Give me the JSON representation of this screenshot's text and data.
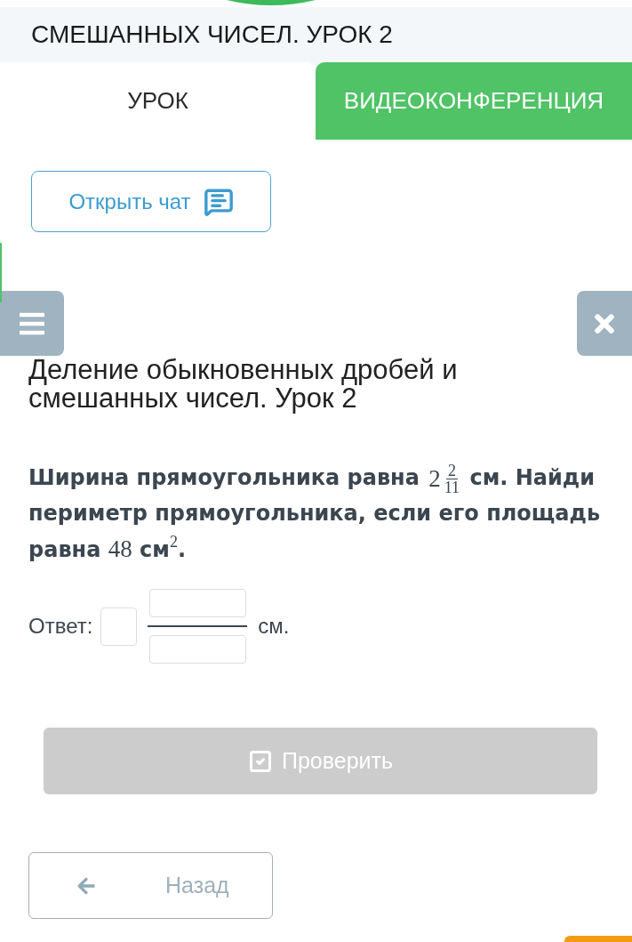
{
  "header": {
    "title": "СМЕШАННЫХ ЧИСЕЛ. УРОК 2"
  },
  "tabs": [
    {
      "label": "УРОК",
      "selected": true
    },
    {
      "label": "ВИДЕОКОНФЕРЕНЦИЯ",
      "selected": false
    }
  ],
  "chat_button": {
    "label": "Открыть чат"
  },
  "lesson_title": "Деление обыкновенных дробей и смешанных чисел. Урок 2",
  "question": [
    {
      "kind": "text",
      "text": "Ширина прямоугольника равна "
    },
    {
      "kind": "mixed",
      "whole": "2",
      "numerator": "2",
      "denominator": "11"
    },
    {
      "kind": "text",
      "text": " см. Найди периметр прямоугольника, если его площадь равна "
    },
    {
      "kind": "math",
      "text": "48"
    },
    {
      "kind": "text",
      "text": " см"
    },
    {
      "kind": "sup",
      "text": "2"
    },
    {
      "kind": "text",
      "text": "."
    }
  ],
  "answer": {
    "label": "Ответ:",
    "unit": "см."
  },
  "check_button": {
    "label": "Проверить",
    "disabled": true
  },
  "back_button": {
    "label": "Назад"
  }
}
